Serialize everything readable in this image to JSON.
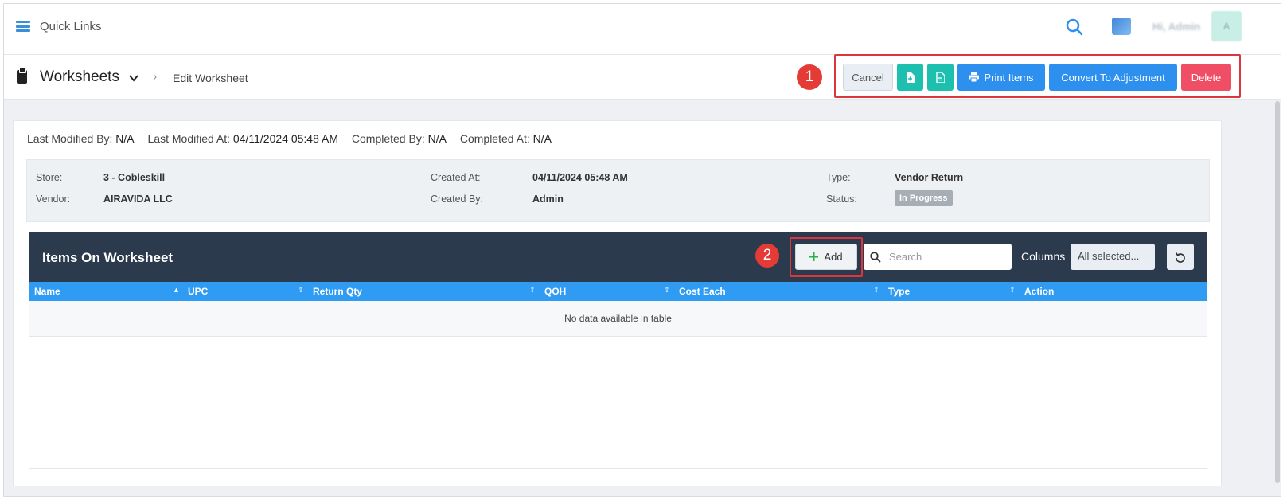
{
  "topbar": {
    "quick_links": "Quick Links",
    "user_greeting": "Hi, Admin",
    "avatar_initial": "A"
  },
  "breadcrumb": {
    "title": "Worksheets",
    "current": "Edit Worksheet",
    "separator": "›"
  },
  "actions": {
    "cancel": "Cancel",
    "print_items": "Print Items",
    "convert": "Convert To Adjustment",
    "delete": "Delete"
  },
  "annotations": {
    "one": "1",
    "two": "2"
  },
  "meta": {
    "last_modified_by_label": "Last Modified By:",
    "last_modified_by": "N/A",
    "last_modified_at_label": "Last Modified At:",
    "last_modified_at": "04/11/2024 05:48 AM",
    "completed_by_label": "Completed By:",
    "completed_by": "N/A",
    "completed_at_label": "Completed At:",
    "completed_at": "N/A"
  },
  "info": {
    "store_label": "Store:",
    "store": "3 - Cobleskill",
    "vendor_label": "Vendor:",
    "vendor": "AIRAVIDA LLC",
    "created_at_label": "Created At:",
    "created_at": "04/11/2024 05:48 AM",
    "created_by_label": "Created By:",
    "created_by": "Admin",
    "type_label": "Type:",
    "type": "Vendor Return",
    "status_label": "Status:",
    "status": "In Progress"
  },
  "table": {
    "title": "Items On Worksheet",
    "add": "Add",
    "search_placeholder": "Search",
    "columns_label": "Columns",
    "columns_value": "All selected...",
    "headers": [
      "Name",
      "UPC",
      "Return Qty",
      "QOH",
      "Cost Each",
      "Type",
      "Action"
    ],
    "empty": "No data available in table"
  },
  "colors": {
    "primary": "#2d8fee",
    "teal": "#1dbfae",
    "danger": "#f04e64",
    "panel": "#2c3a4e",
    "annotation": "#e53b37"
  }
}
